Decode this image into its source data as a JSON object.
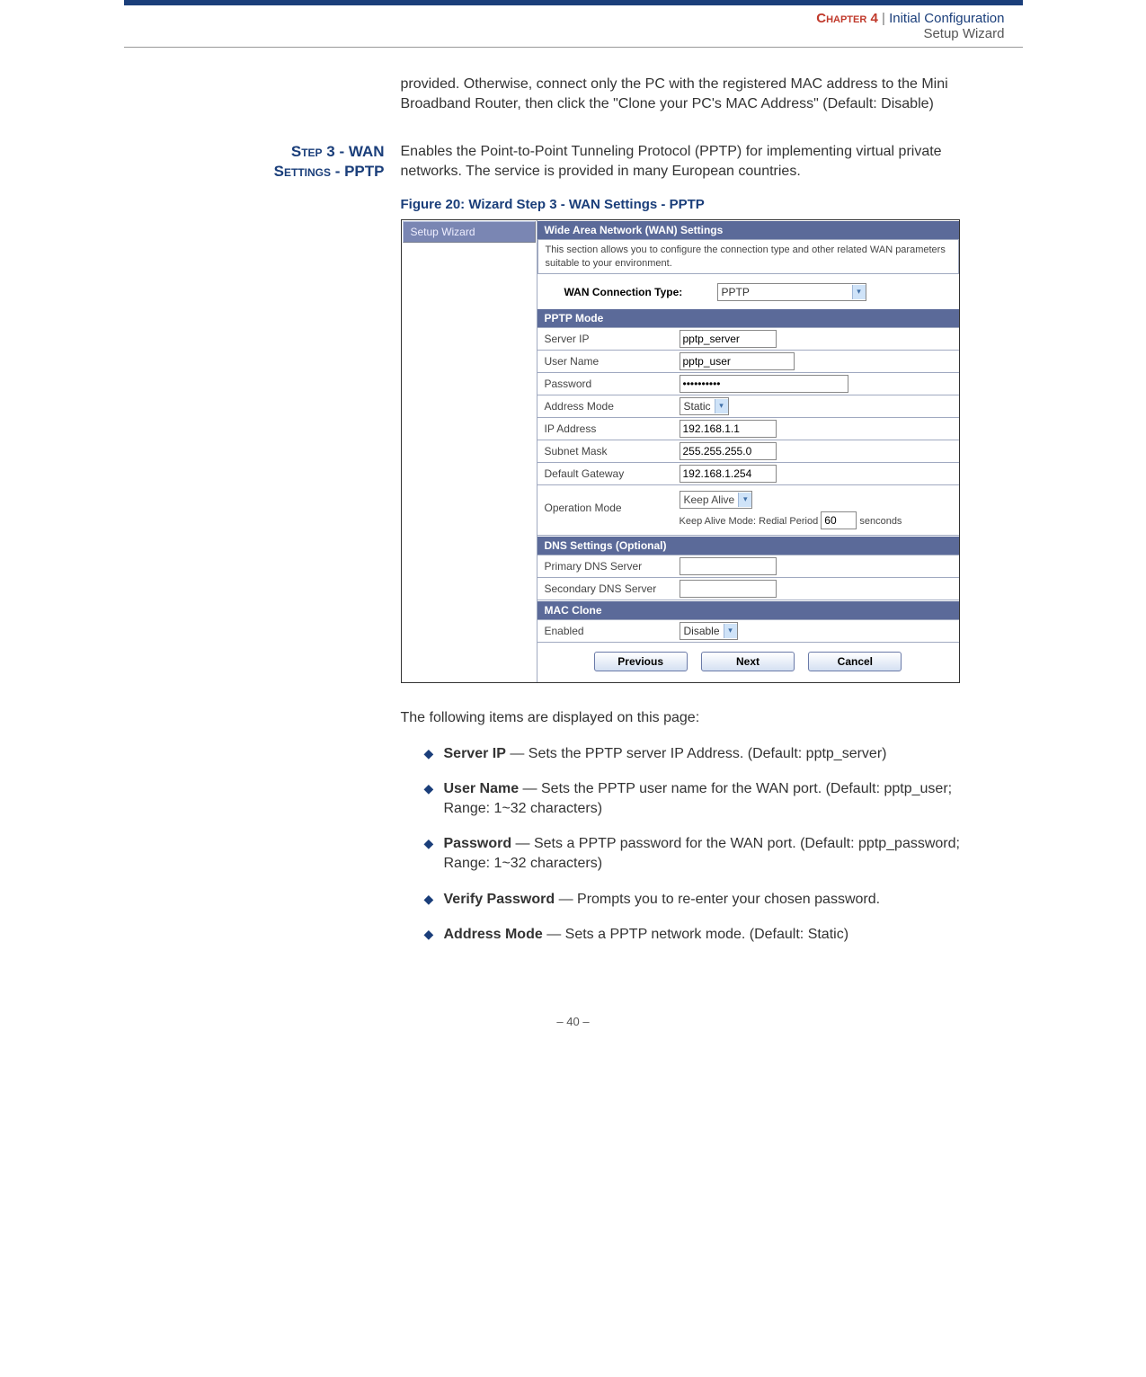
{
  "header": {
    "chapter": "Chapter 4",
    "separator": "|",
    "title_primary": "Initial Configuration",
    "title_secondary": "Setup Wizard"
  },
  "intro_para": "provided. Otherwise, connect only the PC with the registered MAC address to the Mini Broadband Router, then click the \"Clone your PC's MAC Address\" (Default: Disable)",
  "side_heading_line1": "Step 3 - WAN",
  "side_heading_line2": "Settings - PPTP",
  "desc_para": "Enables the Point-to-Point Tunneling Protocol (PPTP) for implementing virtual private networks. The service is provided in many European countries.",
  "fig_caption": "Figure 20:  Wizard Step 3 - WAN Settings - PPTP",
  "figure": {
    "sidebar_item": "Setup Wizard",
    "section_wan": "Wide Area Network (WAN) Settings",
    "wan_desc": "This section allows you to configure the connection type and other related WAN parameters suitable to your environment.",
    "wan_type_label": "WAN Connection Type:",
    "wan_type_value": "PPTP",
    "section_pptp": "PPTP Mode",
    "rows": {
      "server_ip_label": "Server IP",
      "server_ip_value": "pptp_server",
      "user_label": "User Name",
      "user_value": "pptp_user",
      "pass_label": "Password",
      "pass_value": "••••••••••",
      "addr_mode_label": "Address Mode",
      "addr_mode_value": "Static",
      "ip_label": "IP Address",
      "ip_value": "192.168.1.1",
      "mask_label": "Subnet Mask",
      "mask_value": "255.255.255.0",
      "gw_label": "Default Gateway",
      "gw_value": "192.168.1.254",
      "op_label": "Operation Mode",
      "op_value": "Keep Alive",
      "op_note_prefix": "Keep Alive Mode: Redial Period",
      "op_note_value": "60",
      "op_note_suffix": "senconds"
    },
    "section_dns": "DNS Settings (Optional)",
    "dns1_label": "Primary DNS Server",
    "dns2_label": "Secondary DNS Server",
    "section_mac": "MAC Clone",
    "mac_label": "Enabled",
    "mac_value": "Disable",
    "btn_prev": "Previous",
    "btn_next": "Next",
    "btn_cancel": "Cancel"
  },
  "explain_intro": "The following items are displayed on this page:",
  "items": [
    {
      "title": "Server IP",
      "rest": " — Sets the PPTP server IP Address. (Default: pptp_server)"
    },
    {
      "title": "User Name",
      "rest": " — Sets the PPTP user name for the WAN port. (Default: pptp_user; Range: 1~32 characters)"
    },
    {
      "title": "Password",
      "rest": " — Sets a PPTP password for the WAN port. (Default: pptp_password; Range: 1~32 characters)"
    },
    {
      "title": "Verify Password",
      "rest": " — Prompts you to re-enter your chosen password."
    },
    {
      "title": "Address Mode",
      "rest": " — Sets a PPTP network mode. (Default: Static)"
    }
  ],
  "footer": "–  40  –"
}
